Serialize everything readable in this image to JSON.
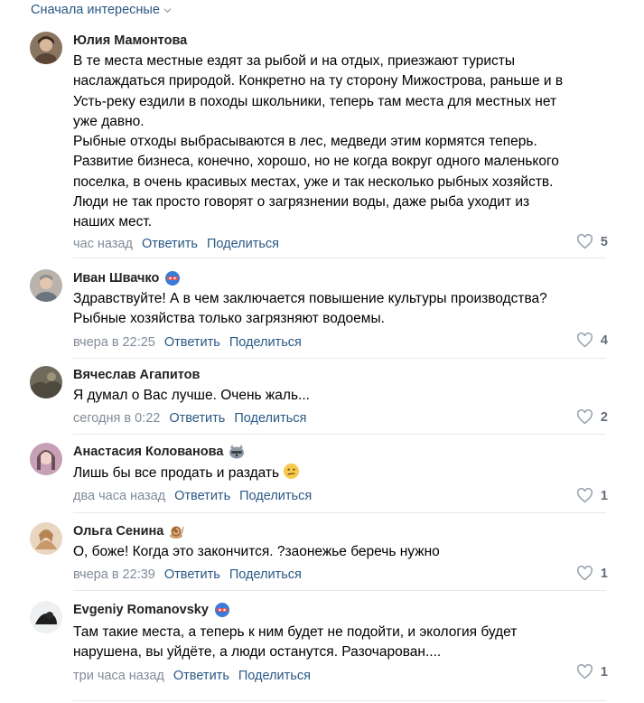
{
  "sort_label": "Сначала интересные",
  "comments": [
    {
      "author": "Юлия Мамонтова",
      "text": "В те места местные ездят за рыбой и на отдых, приезжают туристы\nнаслаждаться природой. Конкретно на ту сторону Мижострова, раньше и в\nУсть-реку ездили в походы школьники, теперь там места для местных нет\nуже давно.\nРыбные отходы выбрасываются в лес, медведи этим кормятся теперь.\nРазвитие бизнеса, конечно, хорошо, но не когда вокруг одного маленького\nпоселка, в очень красивых местах, уже и так несколько рыбных хозяйств.\nЛюди не так просто говорят о загрязнении воды, даже рыба уходит из\nнаших мест.",
      "time": "час назад",
      "reply": "Ответить",
      "share": "Поделиться",
      "likes": "5"
    },
    {
      "author": "Иван Швачко",
      "text": "Здравствуйте! А в чем заключается повышение культуры производства?\nРыбные хозяйства только загрязняют водоемы.",
      "time": "вчера в 22:25",
      "reply": "Ответить",
      "share": "Поделиться",
      "likes": "4"
    },
    {
      "author": "Вячеслав Агапитов",
      "text": "Я думал о Вас лучше. Очень жаль...",
      "time": "сегодня в 0:22",
      "reply": "Ответить",
      "share": "Поделиться",
      "likes": "2"
    },
    {
      "author": "Анастасия Колованова",
      "text": "Лишь бы все продать и раздать",
      "time": "два часа назад",
      "reply": "Ответить",
      "share": "Поделиться",
      "likes": "1"
    },
    {
      "author": "Ольга Сенина",
      "text": "О, боже! Когда это закончится. ?заонежье беречь нужно",
      "time": "вчера в 22:39",
      "reply": "Ответить",
      "share": "Поделиться",
      "likes": "1"
    },
    {
      "author": "Evgeniy Romanovsky",
      "text": "Там такие места, а теперь к ним будет не подойти, и экология будет\nнарушена, вы уйдёте, а люди останутся. Разочарован....",
      "time": "три часа назад",
      "reply": "Ответить",
      "share": "Поделиться",
      "likes": "1"
    }
  ],
  "colors": {
    "link": "#2a5885",
    "meta": "#818c99",
    "divider": "#e7e8ec"
  }
}
